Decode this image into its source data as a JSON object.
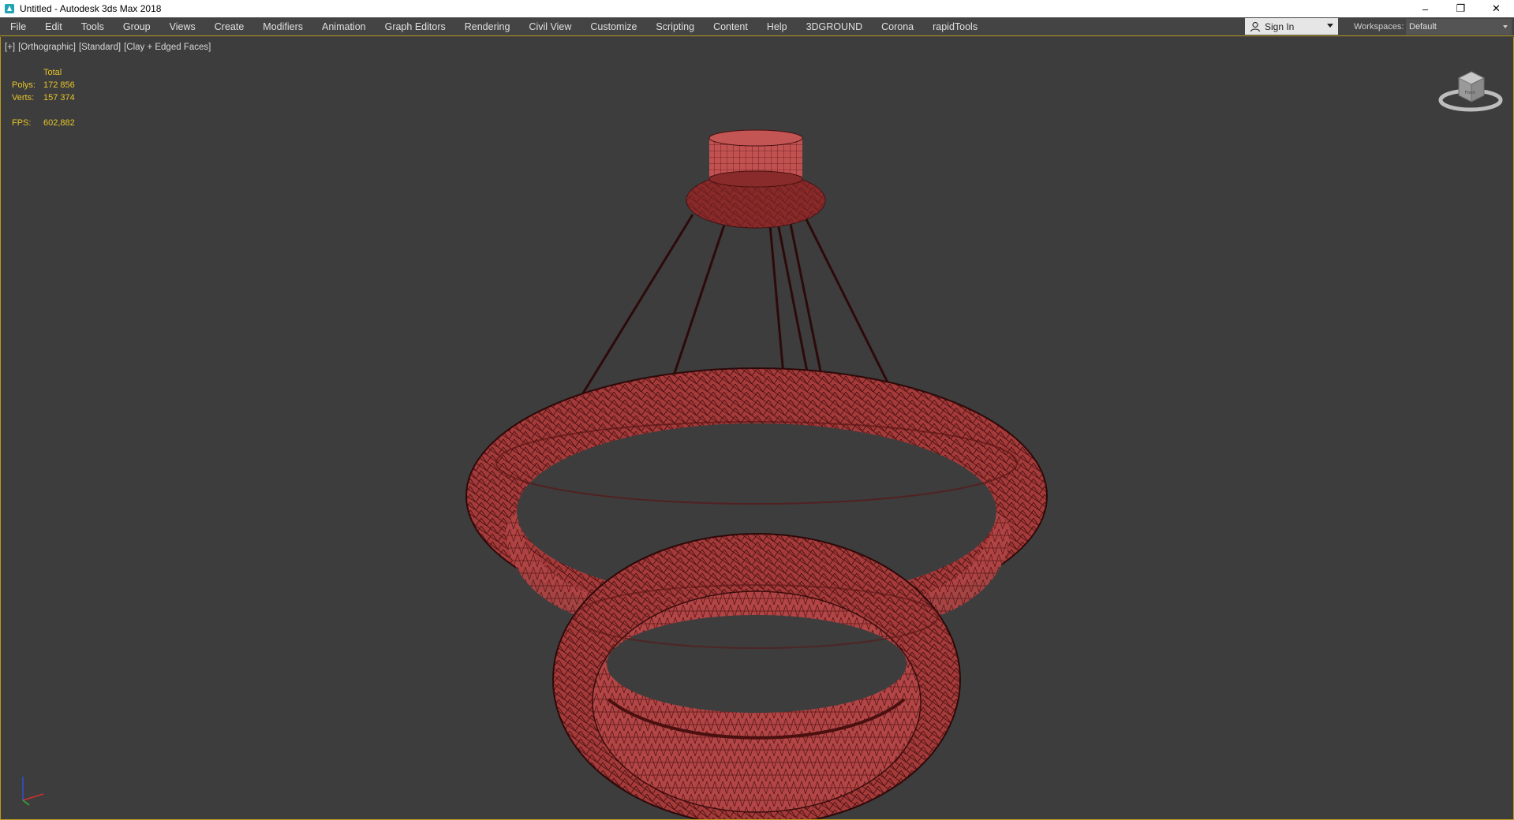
{
  "window": {
    "title": "Untitled - Autodesk 3ds Max 2018",
    "controls": {
      "minimize": "–",
      "restore": "❐",
      "close": "✕"
    }
  },
  "menubar": {
    "items": [
      "File",
      "Edit",
      "Tools",
      "Group",
      "Views",
      "Create",
      "Modifiers",
      "Animation",
      "Graph Editors",
      "Rendering",
      "Civil View",
      "Customize",
      "Scripting",
      "Content",
      "Help",
      "3DGROUND",
      "Corona",
      "rapidTools"
    ],
    "sign_in": "Sign In",
    "workspaces_label": "Workspaces:",
    "workspace_value": "Default"
  },
  "viewport": {
    "labels": [
      "[+]",
      "[Orthographic]",
      "[Standard]",
      "[Clay + Edged Faces]"
    ],
    "stats": {
      "header": "Total",
      "polys_label": "Polys:",
      "polys_value": "172 856",
      "verts_label": "Verts:",
      "verts_value": "157 374",
      "fps_label": "FPS:",
      "fps_value": "602,882"
    },
    "viewcube_label": "Front"
  },
  "colors": {
    "accent_border": "#b89a20",
    "stats_text": "#e6c52a",
    "model_fill": "#9e3434",
    "model_wire": "#3a0c0c"
  }
}
